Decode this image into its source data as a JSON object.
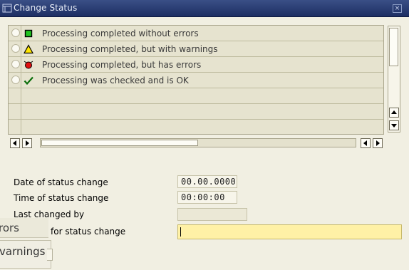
{
  "window": {
    "title": "Change Status",
    "close_glyph": "×"
  },
  "status_table": {
    "rows": [
      {
        "icon": "green-square-icon",
        "label": "Processing completed without errors"
      },
      {
        "icon": "yellow-triangle-icon",
        "label": "Processing completed, but with warnings"
      },
      {
        "icon": "red-circle-icon",
        "label": "Processing completed, but has errors"
      },
      {
        "icon": "green-checkmark-icon",
        "label": "Processing was checked and is OK"
      },
      {
        "icon": "",
        "label": ""
      },
      {
        "icon": "",
        "label": ""
      },
      {
        "icon": "",
        "label": ""
      }
    ]
  },
  "form": {
    "date_label": "Date of status change",
    "date_value": "00.00.0000",
    "time_label": "Time of status change",
    "time_value": "00:00:00",
    "changed_by_label": "Last changed by",
    "changed_by_value": "",
    "reason_label": "for status change",
    "reason_value": ""
  },
  "overlay": {
    "fragment_errors": "rors",
    "fragment_warnings": "varnings",
    "fragment_bottom": "..."
  },
  "colors": {
    "titlebar": "#1d2e63",
    "background": "#f1efe2",
    "required_field": "#fff1a6"
  }
}
